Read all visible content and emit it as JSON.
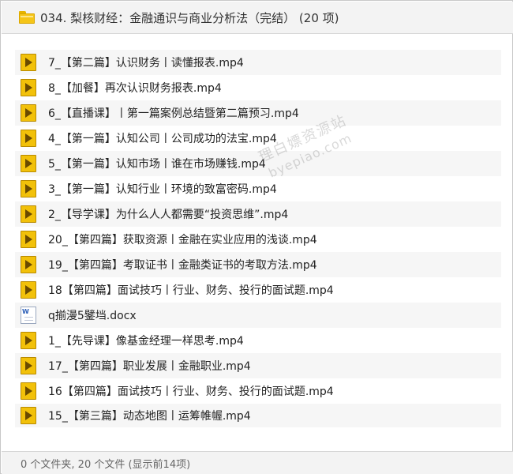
{
  "header": {
    "title": "034. 梨核财经：金融通识与商业分析法（完结） (20 项)",
    "icon": "folder-icon"
  },
  "files": [
    {
      "name": "7_【第二篇】认识财务丨读懂报表.mp4",
      "icon": "video-file-icon"
    },
    {
      "name": "8_【加餐】再次认识财务报表.mp4",
      "icon": "video-file-icon"
    },
    {
      "name": "6_【直播课】丨第一篇案例总结暨第二篇预习.mp4",
      "icon": "video-file-icon"
    },
    {
      "name": "4_【第一篇】认知公司丨公司成功的法宝.mp4",
      "icon": "video-file-icon"
    },
    {
      "name": "5_【第一篇】认知市场丨谁在市场赚钱.mp4",
      "icon": "video-file-icon"
    },
    {
      "name": "3_【第一篇】认知行业丨环境的致富密码.mp4",
      "icon": "video-file-icon"
    },
    {
      "name": "2_【导学课】为什么人人都需要“投资思维”.mp4",
      "icon": "video-file-icon"
    },
    {
      "name": "20_【第四篇】获取资源丨金融在实业应用的浅谈.mp4",
      "icon": "video-file-icon"
    },
    {
      "name": "19_【第四篇】考取证书丨金融类证书的考取方法.mp4",
      "icon": "video-file-icon"
    },
    {
      "name": "18【第四篇】面试技巧丨行业、财务、投行的面试题.mp4",
      "icon": "video-file-icon"
    },
    {
      "name": "q揃漫5鐾垱.docx",
      "icon": "word-doc-icon"
    },
    {
      "name": "1_【先导课】像基金经理一样思考.mp4",
      "icon": "video-file-icon"
    },
    {
      "name": "17_【第四篇】职业发展丨金融职业.mp4",
      "icon": "video-file-icon"
    },
    {
      "name": "16【第四篇】面试技巧丨行业、财务、投行的面试题.mp4",
      "icon": "video-file-icon"
    },
    {
      "name": "15_【第三篇】动态地图丨运筹帷幄.mp4",
      "icon": "video-file-icon"
    }
  ],
  "footer": {
    "summary": "0 个文件夹, 20 个文件 (显示前14项)"
  },
  "watermark": {
    "line1": "理白嫖资源站",
    "line2": "byepiao.com"
  },
  "colors": {
    "header_bg": "#f3f3f3",
    "row_bg": "#f6f6f6",
    "video_icon": "#f2c10a",
    "folder_icon": "#f5c518"
  }
}
